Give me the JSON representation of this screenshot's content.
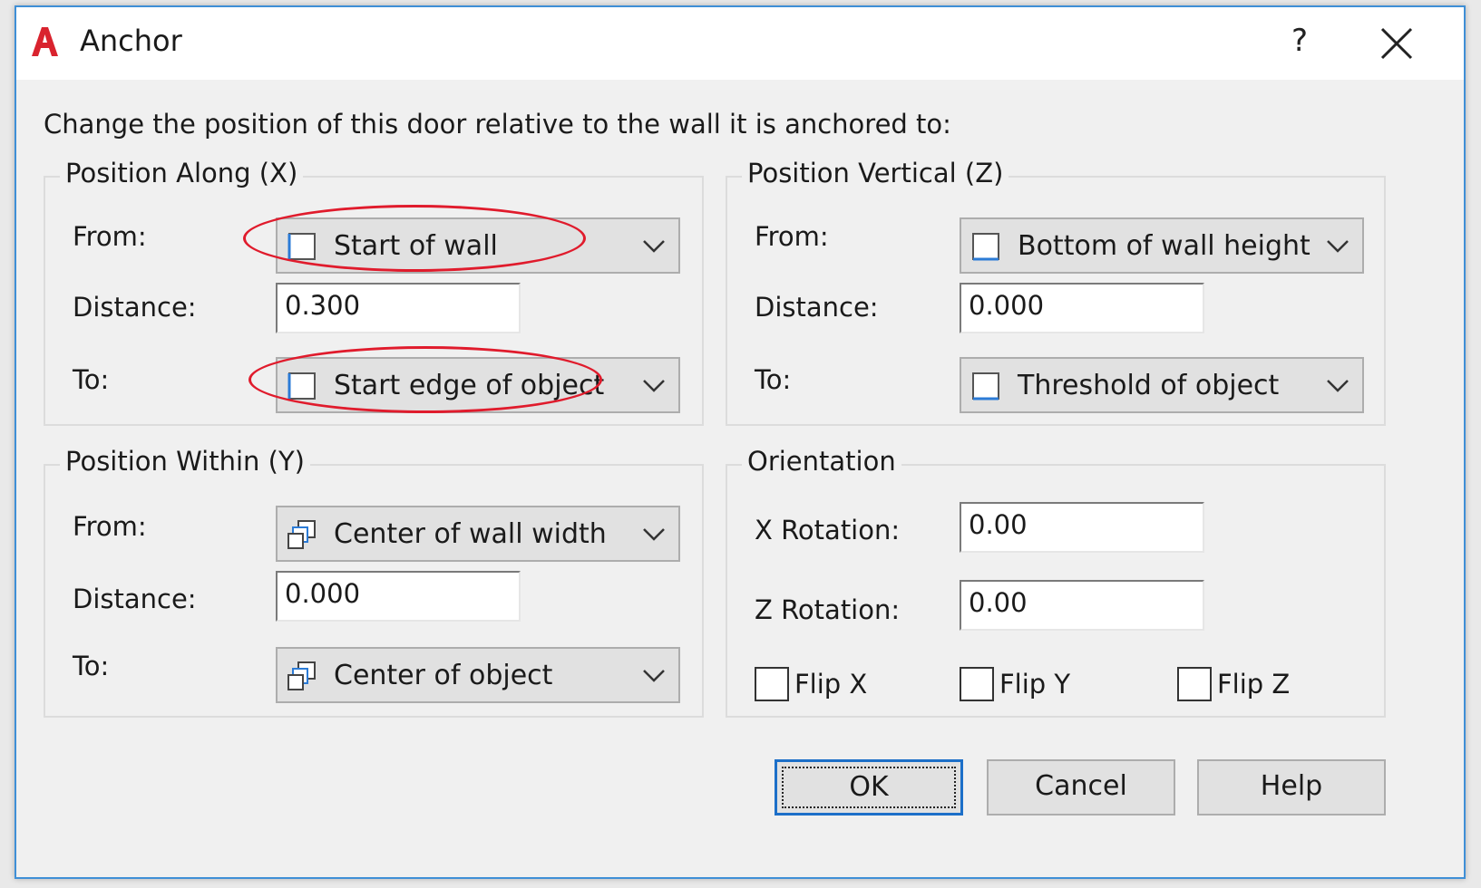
{
  "window": {
    "title": "Anchor",
    "help_label": "?",
    "close_icon": "close-icon",
    "app_icon": "autocad-logo-icon"
  },
  "instruction": "Change the position of this door relative to the wall it is anchored to:",
  "position_along": {
    "legend": "Position Along (X)",
    "from_label": "From:",
    "from_value": "Start of wall",
    "distance_label": "Distance:",
    "distance_value": "0.300",
    "to_label": "To:",
    "to_value": "Start edge of object"
  },
  "position_vertical": {
    "legend": "Position Vertical (Z)",
    "from_label": "From:",
    "from_value": "Bottom of wall height",
    "distance_label": "Distance:",
    "distance_value": "0.000",
    "to_label": "To:",
    "to_value": "Threshold of object"
  },
  "position_within": {
    "legend": "Position Within (Y)",
    "from_label": "From:",
    "from_value": "Center of wall width",
    "distance_label": "Distance:",
    "distance_value": "0.000",
    "to_label": "To:",
    "to_value": "Center of object"
  },
  "orientation": {
    "legend": "Orientation",
    "x_rotation_label": "X Rotation:",
    "x_rotation_value": "0.00",
    "z_rotation_label": "Z Rotation:",
    "z_rotation_value": "0.00",
    "flip_x_label": "Flip X",
    "flip_y_label": "Flip Y",
    "flip_z_label": "Flip Z"
  },
  "buttons": {
    "ok": "OK",
    "cancel": "Cancel",
    "help": "Help"
  },
  "colors": {
    "highlight_oval": "#e01b2c",
    "accent_border": "#1c6fc8"
  }
}
